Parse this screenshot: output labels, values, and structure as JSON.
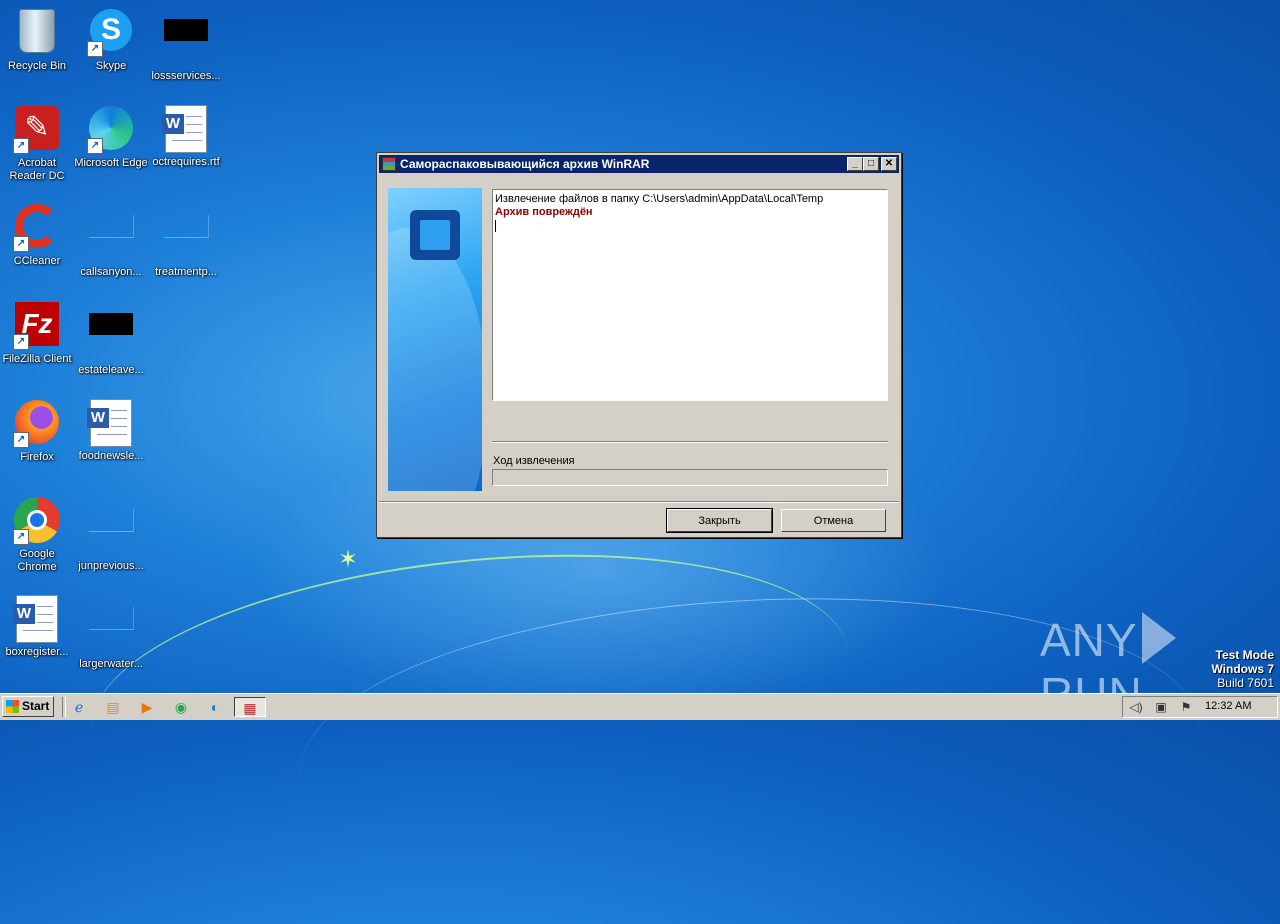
{
  "desktop": {
    "icons": [
      {
        "label": "Recycle Bin"
      },
      {
        "label": "Skype"
      },
      {
        "label": "lossservices..."
      },
      {
        "label": "Acrobat Reader DC"
      },
      {
        "label": "Microsoft Edge"
      },
      {
        "label": "octrequires.rtf"
      },
      {
        "label": "CCleaner"
      },
      {
        "label": "callsanyon..."
      },
      {
        "label": "treatmentp..."
      },
      {
        "label": "FileZilla Client"
      },
      {
        "label": "estateleave..."
      },
      {
        "label": "Firefox"
      },
      {
        "label": "foodnewsle..."
      },
      {
        "label": "Google Chrome"
      },
      {
        "label": "junprevious..."
      },
      {
        "label": "boxregister..."
      },
      {
        "label": "largerwater..."
      }
    ]
  },
  "dialog": {
    "title": "Самораспаковывающийся архив WinRAR",
    "log_line1": "Извлечение файлов в папку C:\\Users\\admin\\AppData\\Local\\Temp",
    "log_line2": "Архив повреждён",
    "progress_label": "Ход извлечения",
    "progress_value": 0,
    "close_button": "Закрыть",
    "cancel_button": "Отмена"
  },
  "watermark": {
    "left": "ANY",
    "right": "RUN"
  },
  "os_info": {
    "line1": "Test Mode",
    "line2": "Windows 7",
    "line3": "Build 7601"
  },
  "taskbar": {
    "start_label": "Start",
    "clock": "12:32 AM"
  }
}
